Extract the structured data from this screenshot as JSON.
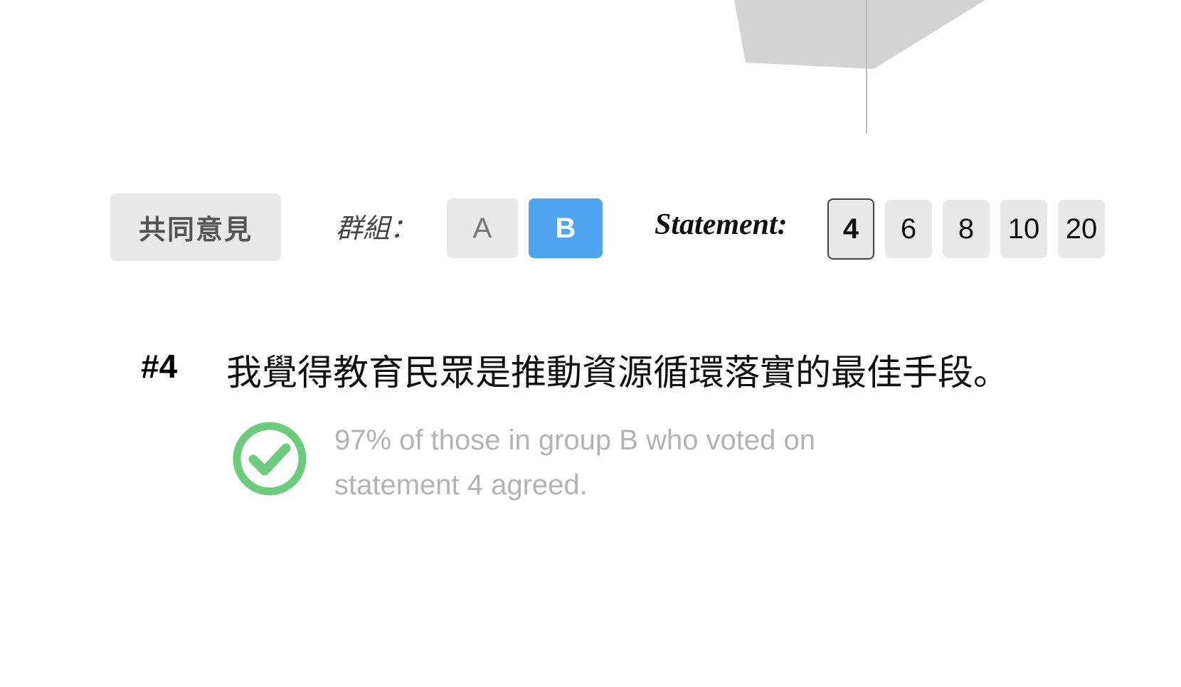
{
  "filters": {
    "common_label": "共同意見",
    "group_label": "群組：",
    "groups": [
      {
        "label": "A",
        "selected": false
      },
      {
        "label": "B",
        "selected": true
      }
    ],
    "statement_label": "Statement:",
    "statements": [
      {
        "label": "4",
        "selected": true
      },
      {
        "label": "6",
        "selected": false
      },
      {
        "label": "8",
        "selected": false
      },
      {
        "label": "10",
        "selected": false
      },
      {
        "label": "20",
        "selected": false
      }
    ]
  },
  "statement": {
    "number": "#4",
    "text": "我覺得教育民眾是推動資源循環落實的最佳手段。",
    "summary": "97% of those in group B who voted on statement 4 agreed.",
    "agree_icon": "check-circle-icon"
  },
  "colors": {
    "selected_group": "#4ea5ed",
    "agree": "#6ccb7c",
    "button_bg": "#e9e9e9",
    "muted_text": "#b3b3b3"
  }
}
